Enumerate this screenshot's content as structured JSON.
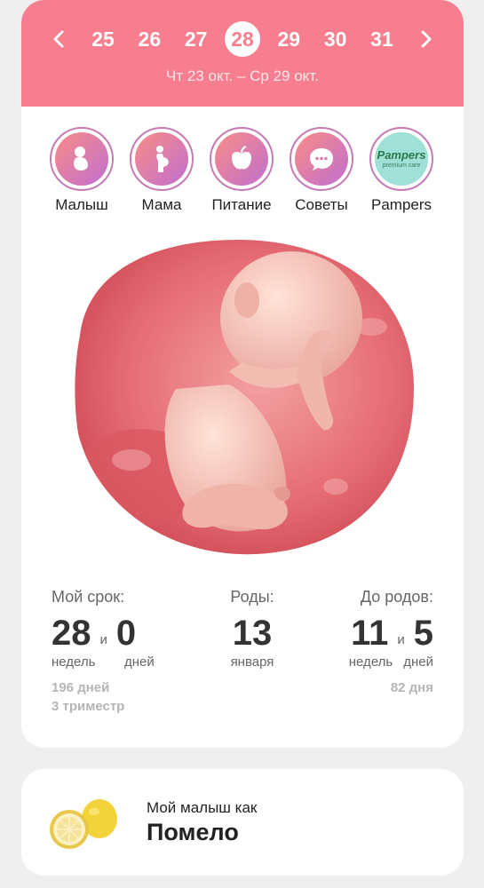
{
  "header": {
    "days": [
      "25",
      "26",
      "27",
      "28",
      "29",
      "30",
      "31"
    ],
    "selected_day": "28",
    "date_range": "Чт 23 окт. – Ср 29 окт.",
    "background_color": "#f77e8e"
  },
  "categories": [
    {
      "label": "Малыш",
      "icon": "baby-icon"
    },
    {
      "label": "Мама",
      "icon": "mother-icon"
    },
    {
      "label": "Питание",
      "icon": "apple-icon"
    },
    {
      "label": "Советы",
      "icon": "chat-bubble-icon"
    },
    {
      "label": "Pampers",
      "icon": "pampers-logo",
      "logo_text": "Pampers",
      "logo_subtext": "premium care"
    }
  ],
  "stats": {
    "term": {
      "title": "Мой срок:",
      "weeks": "28",
      "conj": "и",
      "days": "0",
      "weeks_unit": "недель",
      "days_unit": "дней",
      "total_days": "196 дней",
      "trimester": "3 триместр"
    },
    "birth": {
      "title": "Роды:",
      "day": "13",
      "month": "января"
    },
    "remaining": {
      "title": "До родов:",
      "weeks": "11",
      "conj": "и",
      "days": "5",
      "weeks_unit": "недель",
      "days_unit": "дней",
      "total_days": "82 дня"
    }
  },
  "fruit": {
    "subtitle": "Мой малыш как",
    "name": "Помело"
  }
}
